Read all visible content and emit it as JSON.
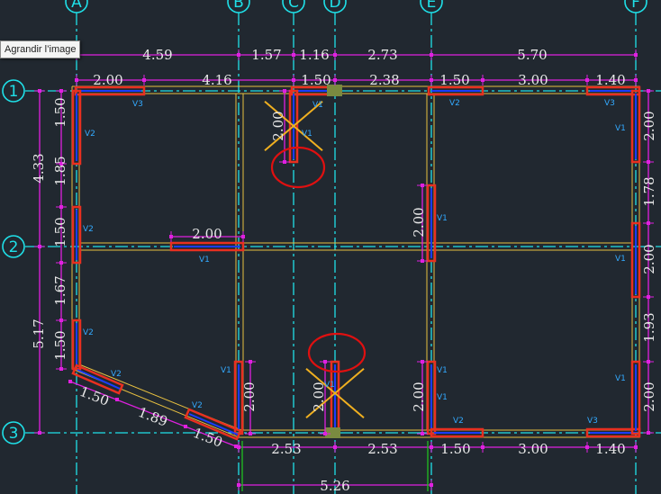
{
  "tooltip": "Agrandir l’image",
  "grid": {
    "columns": [
      "A",
      "B",
      "C",
      "D",
      "E",
      "F"
    ],
    "rows": [
      "1",
      "2",
      "3"
    ]
  },
  "dims": {
    "top_row1": [
      "4.59",
      "1.57",
      "1.16",
      "2.73",
      "5.70"
    ],
    "top_row2": [
      "2.00",
      "4.16",
      "1.50",
      "2.38",
      "1.50",
      "3.00",
      "1.40"
    ],
    "left_outer": [
      "4.33",
      "5.17"
    ],
    "left_inner": [
      "1.50",
      "1.85",
      "1.50",
      "1.67",
      "1.50"
    ],
    "right_side": [
      "2.00",
      "1.78",
      "2.00",
      "1.93",
      "2.00"
    ],
    "inner_vertical": [
      "2.00",
      "2.00",
      "2.00",
      "2.00",
      "2.00"
    ],
    "inner_horizontal": "2.00",
    "diagonal": [
      "1.50",
      "1.89",
      "1.50"
    ],
    "bottom_row1": [
      "2.53",
      "2.53",
      "1.50",
      "3.00",
      "1.40"
    ],
    "bottom_row2": "5.26"
  },
  "wall_labels": [
    "V1",
    "V2",
    "V3"
  ],
  "colors": {
    "background": "#212830",
    "grid_axis": "#1fe0e8",
    "dimension_line": "#e020e0",
    "wall_outline": "#e83020",
    "wall_core": "#1a3cff",
    "beam_outline": "#e8c040",
    "annotation_circle": "#e01010",
    "cross_mark": "#f0b020",
    "column_block": "#7a8a40",
    "ext_line": "#20c020"
  }
}
